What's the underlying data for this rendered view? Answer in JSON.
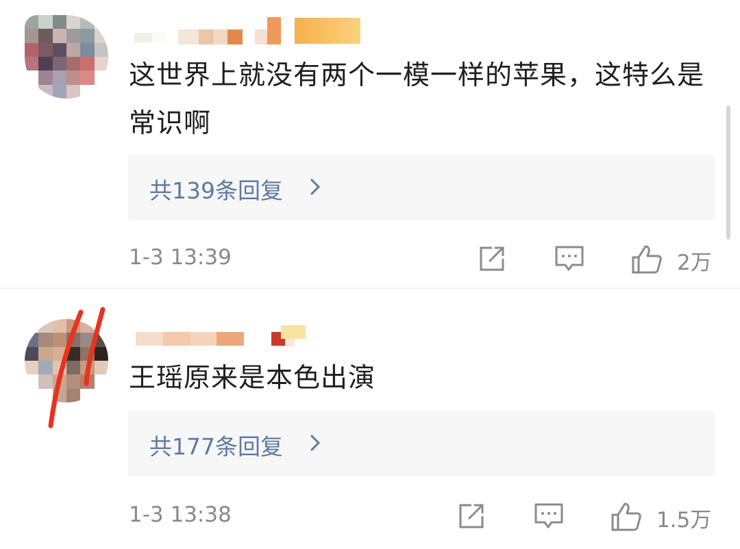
{
  "comments": [
    {
      "text": "这世界上就没有两个一模一样的苹果，这特么是常识啊",
      "replies_label": "共139条回复",
      "time": "1-3 13:39",
      "likes": "2万"
    },
    {
      "text": "王瑶原来是本色出演",
      "replies_label": "共177条回复",
      "time": "1-3 13:38",
      "likes": "1.5万"
    }
  ],
  "icons": {
    "share": "share-icon",
    "comment": "comment-icon",
    "like": "thumbs-up-icon",
    "chevron": "chevron-right-icon"
  },
  "colors": {
    "reply_link": "#5d7aa1",
    "meta_text": "#888888",
    "reply_box": "#f7f7f7"
  }
}
